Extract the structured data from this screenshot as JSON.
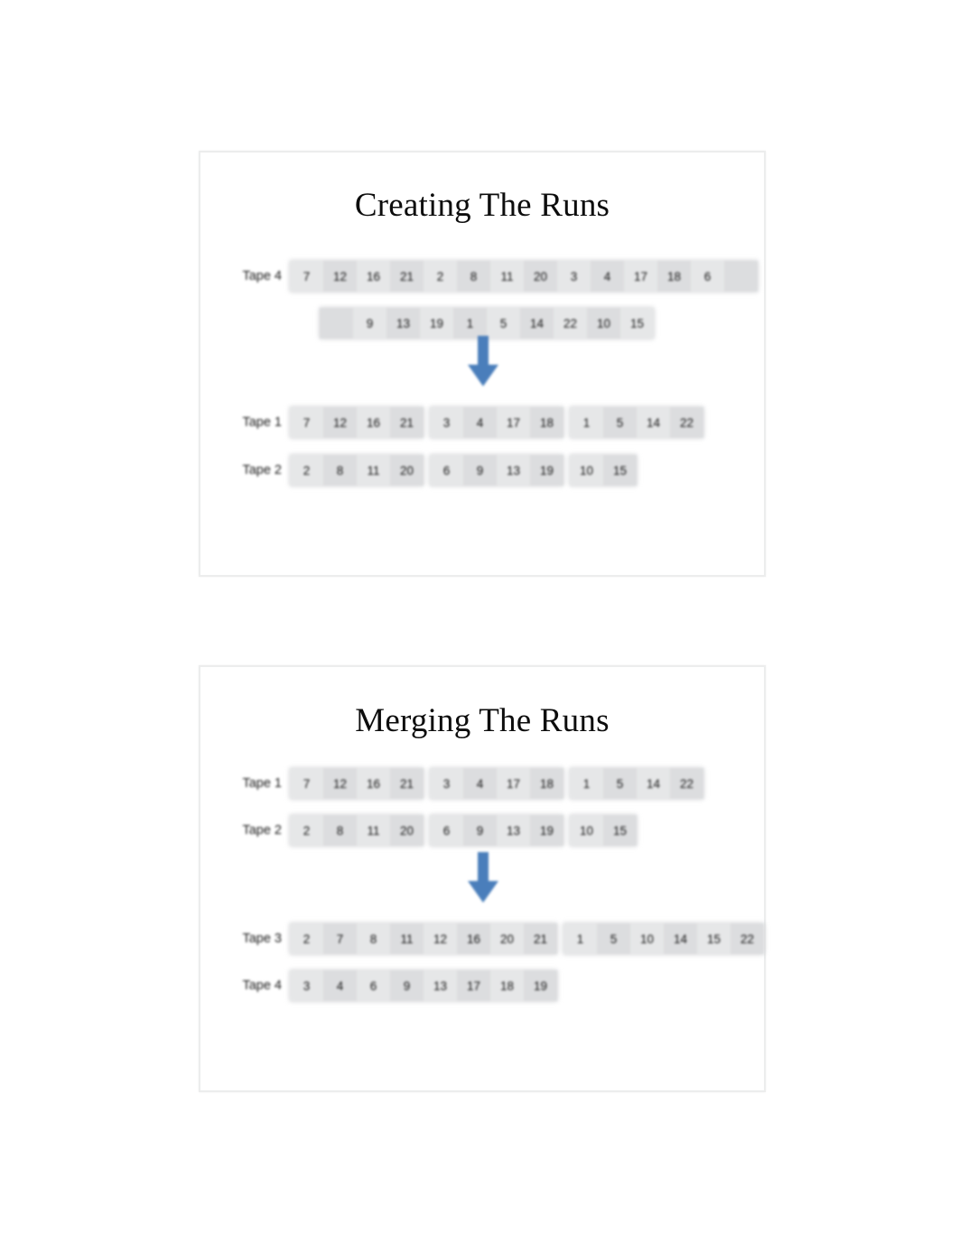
{
  "page": {
    "background": "#ffffff",
    "slide_border_color": "#eceded",
    "cell_color": "#e6e7e8",
    "cell_alt_color": "#dcdddf",
    "arrow_color": "#4a7ebb",
    "text_color": "#141414"
  },
  "slides": [
    {
      "id": "creating-the-runs",
      "title": "Creating The Runs",
      "rows": [
        {
          "label": "Tape 4",
          "groups": [
            {
              "values": [
                "7",
                "12",
                "16",
                "21",
                "2",
                "8",
                "11",
                "20",
                "3",
                "4",
                "17",
                "18",
                "6",
                ""
              ]
            }
          ]
        },
        {
          "label": "",
          "groups": [
            {
              "values": [
                "",
                "9",
                "13",
                "19",
                "1",
                "5",
                "14",
                "22",
                "10",
                "15"
              ]
            }
          ]
        },
        {
          "label": "Tape 1",
          "groups": [
            {
              "values": [
                "7",
                "12",
                "16",
                "21"
              ]
            },
            {
              "values": [
                "3",
                "4",
                "17",
                "18"
              ]
            },
            {
              "values": [
                "1",
                "5",
                "14",
                "22"
              ]
            }
          ]
        },
        {
          "label": "Tape 2",
          "groups": [
            {
              "values": [
                "2",
                "8",
                "11",
                "20"
              ]
            },
            {
              "values": [
                "6",
                "9",
                "13",
                "19"
              ]
            },
            {
              "values": [
                "10",
                "15"
              ]
            }
          ]
        }
      ],
      "arrow": {
        "direction": "down",
        "color": "#4a7ebb"
      }
    },
    {
      "id": "merging-the-runs",
      "title": "Merging The Runs",
      "rows": [
        {
          "label": "Tape 1",
          "groups": [
            {
              "values": [
                "7",
                "12",
                "16",
                "21"
              ]
            },
            {
              "values": [
                "3",
                "4",
                "17",
                "18"
              ]
            },
            {
              "values": [
                "1",
                "5",
                "14",
                "22"
              ]
            }
          ]
        },
        {
          "label": "Tape 2",
          "groups": [
            {
              "values": [
                "2",
                "8",
                "11",
                "20"
              ]
            },
            {
              "values": [
                "6",
                "9",
                "13",
                "19"
              ]
            },
            {
              "values": [
                "10",
                "15"
              ]
            }
          ]
        },
        {
          "label": "Tape 3",
          "groups": [
            {
              "values": [
                "2",
                "7",
                "8",
                "11",
                "12",
                "16",
                "20",
                "21"
              ]
            },
            {
              "values": [
                "1",
                "5",
                "10",
                "14",
                "15",
                "22"
              ]
            }
          ]
        },
        {
          "label": "Tape 4",
          "groups": [
            {
              "values": [
                "3",
                "4",
                "6",
                "9",
                "13",
                "17",
                "18",
                "19"
              ]
            }
          ]
        }
      ],
      "arrow": {
        "direction": "down",
        "color": "#4a7ebb"
      }
    }
  ]
}
